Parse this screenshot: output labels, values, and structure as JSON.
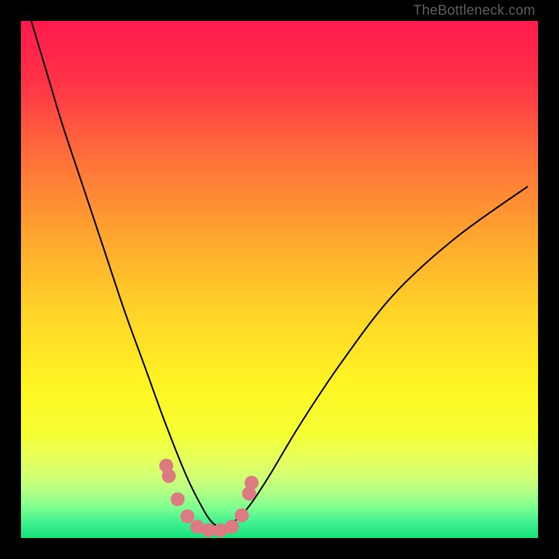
{
  "watermark": "TheBottleneck.com",
  "chart_data": {
    "type": "line",
    "title": "",
    "xlabel": "",
    "ylabel": "",
    "xlim": [
      0,
      1
    ],
    "ylim": [
      0,
      1
    ],
    "series": [
      {
        "name": "curve",
        "x": [
          0.02,
          0.05,
          0.08,
          0.12,
          0.16,
          0.2,
          0.24,
          0.28,
          0.32,
          0.35,
          0.37,
          0.39,
          0.41,
          0.44,
          0.48,
          0.54,
          0.62,
          0.72,
          0.84,
          0.98
        ],
        "y": [
          1.0,
          0.9,
          0.8,
          0.68,
          0.56,
          0.44,
          0.33,
          0.22,
          0.12,
          0.06,
          0.03,
          0.02,
          0.03,
          0.06,
          0.12,
          0.22,
          0.34,
          0.47,
          0.58,
          0.68
        ]
      }
    ],
    "markers": {
      "name": "dots",
      "color": "#dd7b83",
      "x": [
        0.281,
        0.286,
        0.303,
        0.322,
        0.341,
        0.363,
        0.386,
        0.408,
        0.427,
        0.441,
        0.446
      ],
      "y": [
        0.14,
        0.12,
        0.075,
        0.042,
        0.022,
        0.015,
        0.015,
        0.022,
        0.044,
        0.086,
        0.107
      ]
    },
    "gradient_stops": [
      {
        "pos": 0.0,
        "color": "#ff1a4d"
      },
      {
        "pos": 0.12,
        "color": "#ff3347"
      },
      {
        "pos": 0.25,
        "color": "#ff6a3b"
      },
      {
        "pos": 0.4,
        "color": "#ffa030"
      },
      {
        "pos": 0.55,
        "color": "#ffd028"
      },
      {
        "pos": 0.7,
        "color": "#fff423"
      },
      {
        "pos": 0.8,
        "color": "#f6ff33"
      },
      {
        "pos": 0.86,
        "color": "#e0ff66"
      },
      {
        "pos": 0.9,
        "color": "#c0ff80"
      },
      {
        "pos": 0.94,
        "color": "#80ff90"
      },
      {
        "pos": 0.97,
        "color": "#40f090"
      },
      {
        "pos": 1.0,
        "color": "#16e37a"
      }
    ],
    "green_band": {
      "top": 0.955,
      "bottom": 1.0
    }
  }
}
